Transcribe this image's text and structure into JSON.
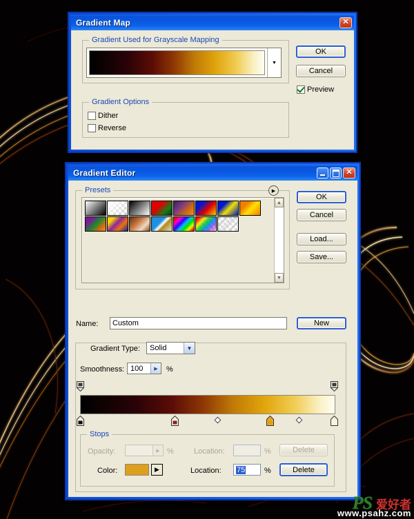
{
  "background": {
    "description": "black background with golden light-trail streaks",
    "base_color": "#030102",
    "streak_color": "#f0c070"
  },
  "gradient_map_dialog": {
    "title": "Gradient Map",
    "close_button": "✕",
    "group_gradient": {
      "legend": "Gradient Used for Grayscale Mapping",
      "preview_dropdown_icon": "▼"
    },
    "group_options": {
      "legend": "Gradient Options",
      "dither": {
        "label": "Dither",
        "checked": false
      },
      "reverse": {
        "label": "Reverse",
        "checked": false
      }
    },
    "buttons": {
      "ok": "OK",
      "cancel": "Cancel"
    },
    "preview": {
      "label": "Preview",
      "checked": true
    }
  },
  "gradient_editor_dialog": {
    "title": "Gradient Editor",
    "window_buttons": {
      "minimize": "_",
      "maximize": "□",
      "close": "✕"
    },
    "presets": {
      "legend": "Presets",
      "menu_icon": "▶",
      "scroll_up_icon": "▲",
      "scroll_down_icon": "▼",
      "swatches": [
        "foreground-to-background",
        "foreground-to-transparent",
        "black-white",
        "red-green",
        "violet-orange",
        "blue-red-yellow",
        "blue-yellow-blue",
        "orange-yellow-orange",
        "violet-green-orange",
        "yellow-violet-orange-blue",
        "copper",
        "chrome",
        "spectrum",
        "transparent-rainbow",
        "transparent-stripes"
      ]
    },
    "buttons": {
      "ok": "OK",
      "cancel": "Cancel",
      "load": "Load...",
      "save": "Save...",
      "new": "New"
    },
    "name": {
      "label": "Name:",
      "value": "Custom"
    },
    "gradient_type": {
      "label": "Gradient Type:",
      "value": "Solid",
      "arrow_icon": "▼"
    },
    "smoothness": {
      "label": "Smoothness:",
      "value": "100",
      "unit": "%",
      "arrow_icon": "▶"
    },
    "gradient_bar": {
      "css": "linear-gradient(90deg,#000000 0%,#120203 10%,#2b0307 22%,#5c0c06 36%,#8e3604 48%,#c07a06 60%,#e0a40c 72%,#f0cc52 84%,#faf0c4 94%,#fffdf2 100%)",
      "opacity_stops": [
        {
          "location": 0,
          "color": "#4a4a4a"
        },
        {
          "location": 100,
          "color": "#4a4a4a"
        }
      ],
      "color_stops": [
        {
          "location": 0,
          "color": "#120204"
        },
        {
          "location": 37,
          "color": "#8c2018"
        },
        {
          "location": 75,
          "color": "#dda01c",
          "selected": true
        },
        {
          "location": 100,
          "color": "#fdf6d8"
        }
      ],
      "midpoints": [
        {
          "location": 54
        },
        {
          "location": 86
        }
      ]
    },
    "stops": {
      "legend": "Stops",
      "opacity": {
        "label": "Opacity:",
        "value": "",
        "unit": "%",
        "arrow_icon": "▶",
        "disabled": true
      },
      "opacity_location": {
        "label": "Location:",
        "value": "",
        "unit": "%",
        "disabled": true
      },
      "opacity_delete": {
        "label": "Delete",
        "disabled": true
      },
      "color": {
        "label": "Color:",
        "swatch": "#dda01c",
        "arrow_icon": "▶"
      },
      "color_location": {
        "label": "Location:",
        "value": "75",
        "unit": "%",
        "selected": true
      },
      "color_delete": {
        "label": "Delete",
        "disabled": false
      }
    }
  },
  "watermark": {
    "logo": "PS",
    "chinese": "爱好者",
    "url": "www.psahz.com"
  }
}
